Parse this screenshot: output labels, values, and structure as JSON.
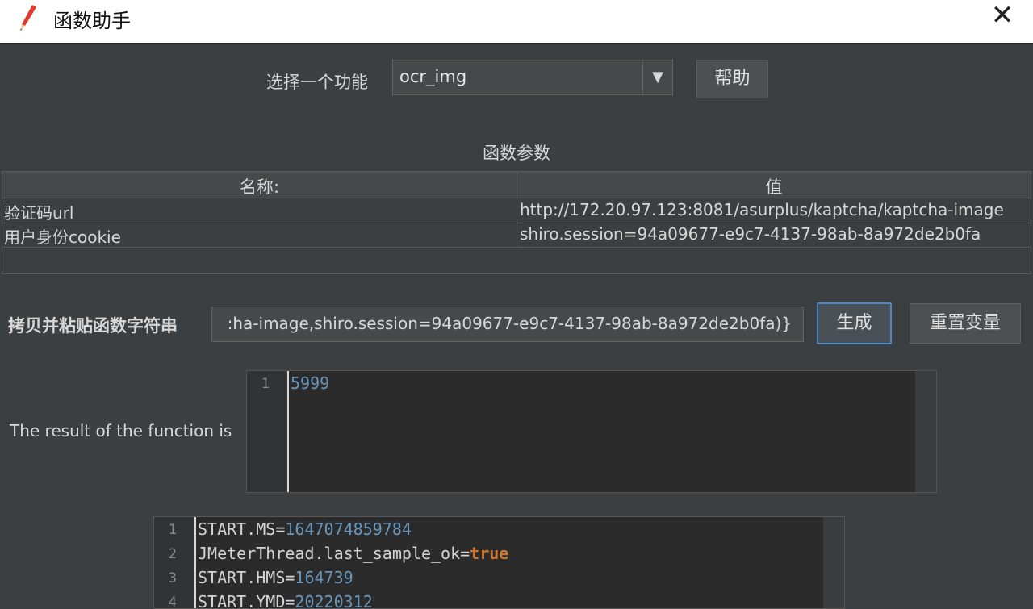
{
  "window": {
    "title": "函数助手",
    "close_glyph": "✕"
  },
  "function_select": {
    "label": "选择一个功能",
    "value": "ocr_img",
    "arrow": "▼",
    "help_button": "帮助"
  },
  "params": {
    "section_title": "函数参数",
    "headers": [
      "名称:",
      "值"
    ],
    "rows": [
      [
        "验证码url",
        "http://172.20.97.123:8081/asurplus/kaptcha/kaptcha-image"
      ],
      [
        "用户身份cookie",
        "shiro.session=94a09677-e9c7-4137-98ab-8a972de2b0fa"
      ]
    ]
  },
  "copy": {
    "label": "拷贝并粘贴函数字符串",
    "value": ":ha-image,shiro.session=94a09677-e9c7-4137-98ab-8a972de2b0fa)}",
    "generate_button": "生成",
    "reset_button": "重置变量"
  },
  "result": {
    "label": "The result of the function is",
    "lines": [
      {
        "n": "1",
        "text": "5999"
      }
    ]
  },
  "vars": {
    "lines": [
      {
        "n": "1",
        "key": "START.MS=",
        "val": "1647074859784",
        "type": "num"
      },
      {
        "n": "2",
        "key": "JMeterThread.last_sample_ok=",
        "val": "true",
        "type": "kw"
      },
      {
        "n": "3",
        "key": "START.HMS=",
        "val": "164739",
        "type": "num"
      },
      {
        "n": "4",
        "key": "START.YMD=",
        "val": "20220312",
        "type": "num"
      }
    ]
  },
  "colors": {
    "background": "#3c3f41",
    "accent": "#4a88c7",
    "number": "#6897bb",
    "keyword": "#cc7832"
  }
}
